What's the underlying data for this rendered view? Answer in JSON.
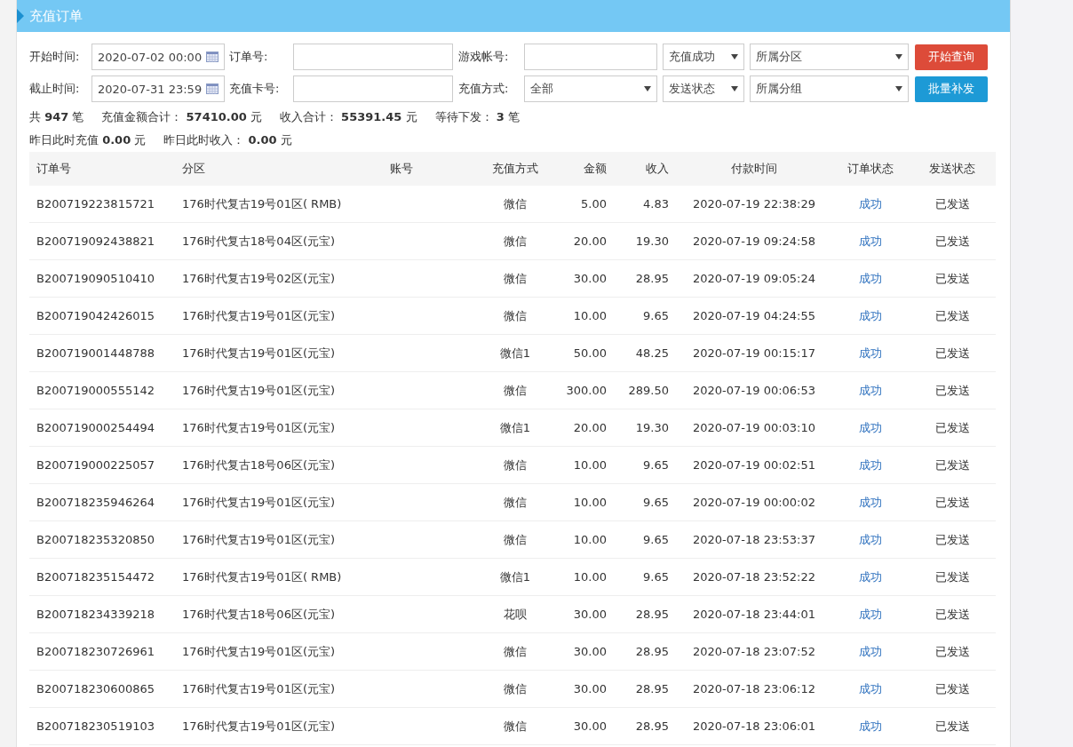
{
  "panel": {
    "title": "充值订单"
  },
  "filters": {
    "start_label": "开始时间:",
    "start_value": "2020-07-02 00:00",
    "end_label": "截止时间:",
    "end_value": "2020-07-31 23:59",
    "order_label": "订单号:",
    "card_label": "充值卡号:",
    "account_label": "游戏帐号:",
    "method_label": "充值方式:",
    "method_value": "全部",
    "status_value": "充值成功",
    "send_value": "发送状态",
    "zone_value": "所属分区",
    "group_value": "所属分组",
    "query_button": "开始查询",
    "resend_button": "批量补发"
  },
  "summary": [
    {
      "label": "共",
      "value": "947",
      "unit": "笔"
    },
    {
      "label": "充值金额合计：",
      "value": "57410.00",
      "unit": "元"
    },
    {
      "label": "收入合计：",
      "value": "55391.45",
      "unit": "元"
    },
    {
      "label": "等待下发：",
      "value": "3",
      "unit": "笔"
    }
  ],
  "yesterday": [
    {
      "label": "昨日此时充值",
      "value": "0.00",
      "unit": "元"
    },
    {
      "label": "昨日此时收入：",
      "value": "0.00",
      "unit": "元"
    }
  ],
  "table": {
    "columns": [
      "订单号",
      "分区",
      "账号",
      "充值方式",
      "金额",
      "收入",
      "付款时间",
      "订单状态",
      "发送状态"
    ],
    "rows": [
      {
        "order": "B200719223815721",
        "zone": "176时代复古19号01区( RMB)",
        "method": "微信",
        "amount": "5.00",
        "income": "4.83",
        "time": "2020-07-19 22:38:29",
        "status": "成功",
        "sent": "已发送"
      },
      {
        "order": "B200719092438821",
        "zone": "176时代复古18号04区(元宝)",
        "method": "微信",
        "amount": "20.00",
        "income": "19.30",
        "time": "2020-07-19 09:24:58",
        "status": "成功",
        "sent": "已发送"
      },
      {
        "order": "B200719090510410",
        "zone": "176时代复古19号02区(元宝)",
        "method": "微信",
        "amount": "30.00",
        "income": "28.95",
        "time": "2020-07-19 09:05:24",
        "status": "成功",
        "sent": "已发送"
      },
      {
        "order": "B200719042426015",
        "zone": "176时代复古19号01区(元宝)",
        "method": "微信",
        "amount": "10.00",
        "income": "9.65",
        "time": "2020-07-19 04:24:55",
        "status": "成功",
        "sent": "已发送"
      },
      {
        "order": "B200719001448788",
        "zone": "176时代复古19号01区(元宝)",
        "method": "微信1",
        "amount": "50.00",
        "income": "48.25",
        "time": "2020-07-19 00:15:17",
        "status": "成功",
        "sent": "已发送"
      },
      {
        "order": "B200719000555142",
        "zone": "176时代复古19号01区(元宝)",
        "method": "微信",
        "amount": "300.00",
        "income": "289.50",
        "time": "2020-07-19 00:06:53",
        "status": "成功",
        "sent": "已发送"
      },
      {
        "order": "B200719000254494",
        "zone": "176时代复古19号01区(元宝)",
        "method": "微信1",
        "amount": "20.00",
        "income": "19.30",
        "time": "2020-07-19 00:03:10",
        "status": "成功",
        "sent": "已发送"
      },
      {
        "order": "B200719000225057",
        "zone": "176时代复古18号06区(元宝)",
        "method": "微信",
        "amount": "10.00",
        "income": "9.65",
        "time": "2020-07-19 00:02:51",
        "status": "成功",
        "sent": "已发送"
      },
      {
        "order": "B200718235946264",
        "zone": "176时代复古19号01区(元宝)",
        "method": "微信",
        "amount": "10.00",
        "income": "9.65",
        "time": "2020-07-19 00:00:02",
        "status": "成功",
        "sent": "已发送"
      },
      {
        "order": "B200718235320850",
        "zone": "176时代复古19号01区(元宝)",
        "method": "微信",
        "amount": "10.00",
        "income": "9.65",
        "time": "2020-07-18 23:53:37",
        "status": "成功",
        "sent": "已发送"
      },
      {
        "order": "B200718235154472",
        "zone": "176时代复古19号01区( RMB)",
        "method": "微信1",
        "amount": "10.00",
        "income": "9.65",
        "time": "2020-07-18 23:52:22",
        "status": "成功",
        "sent": "已发送"
      },
      {
        "order": "B200718234339218",
        "zone": "176时代复古18号06区(元宝)",
        "method": "花呗",
        "amount": "30.00",
        "income": "28.95",
        "time": "2020-07-18 23:44:01",
        "status": "成功",
        "sent": "已发送"
      },
      {
        "order": "B200718230726961",
        "zone": "176时代复古19号01区(元宝)",
        "method": "微信",
        "amount": "30.00",
        "income": "28.95",
        "time": "2020-07-18 23:07:52",
        "status": "成功",
        "sent": "已发送"
      },
      {
        "order": "B200718230600865",
        "zone": "176时代复古19号01区(元宝)",
        "method": "微信",
        "amount": "30.00",
        "income": "28.95",
        "time": "2020-07-18 23:06:12",
        "status": "成功",
        "sent": "已发送"
      },
      {
        "order": "B200718230519103",
        "zone": "176时代复古19号01区(元宝)",
        "method": "微信",
        "amount": "30.00",
        "income": "28.95",
        "time": "2020-07-18 23:06:01",
        "status": "成功",
        "sent": "已发送"
      }
    ]
  }
}
